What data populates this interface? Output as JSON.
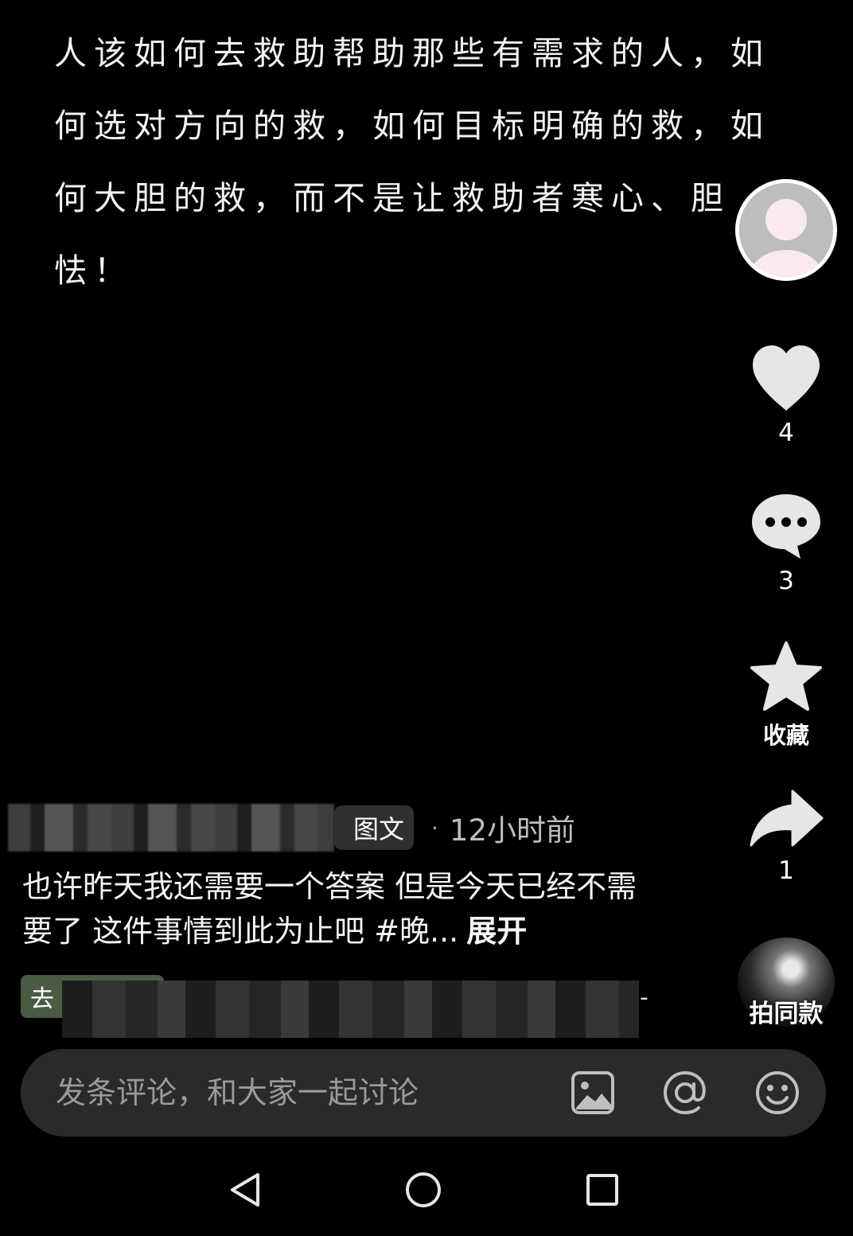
{
  "post": {
    "text": "人该如何去救助帮助那些有需求的人，如何选对方向的救，如何目标明确的救，如何大胆的救，而不是让救助者寒心、胆怯！"
  },
  "rail": {
    "likes": "4",
    "comments": "3",
    "collect_label": "收藏",
    "shares": "1",
    "same_style_label": "拍同款"
  },
  "meta": {
    "type_tag": "图文",
    "separator": "·",
    "time": "12小时前"
  },
  "caption": {
    "text": "也许昨天我还需要一个答案 但是今天已经不需要了 这件事情到此为止吧 #晚...",
    "expand": "展开"
  },
  "go_chip": {
    "label": "去",
    "dash": "-"
  },
  "comment_bar": {
    "placeholder": "发条评论，和大家一起讨论"
  },
  "icons": {
    "avatar": "default-user-avatar",
    "like": "heart-icon",
    "comment": "speech-bubble-icon",
    "collect": "star-icon",
    "share": "share-arrow-icon",
    "image": "image-icon",
    "at": "at-mention-icon",
    "emoji": "smiley-icon",
    "nav_back": "triangle-back-icon",
    "nav_home": "circle-home-icon",
    "nav_recent": "square-recent-icon"
  },
  "colors": {
    "background": "#000000",
    "icon_light": "#e6e6e6",
    "chip_bg": "#2f2f2f",
    "go_chip_bg": "#4a5a44",
    "comment_bar_bg": "#2a2a2a"
  }
}
